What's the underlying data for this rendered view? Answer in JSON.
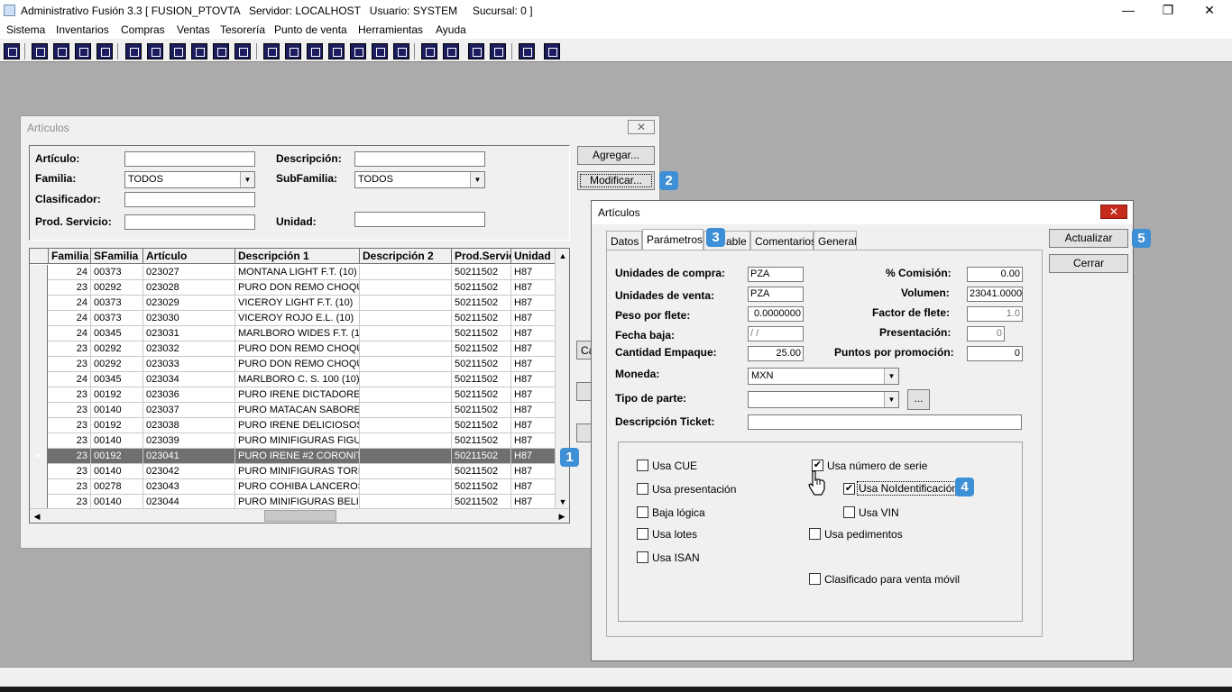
{
  "app": {
    "title": "Administrativo Fusión 3.3 [ FUSION_PTOVTA   Servidor: LOCALHOST   Usuario: SYSTEM     Sucursal: 0 ]",
    "controls": {
      "minimize": "—",
      "maximize": "❐",
      "close": "✕"
    }
  },
  "menu": [
    "Sistema",
    "Inventarios",
    "Compras",
    "Ventas",
    "Tesorería",
    "Punto de venta",
    "Herramientas",
    "Ayuda"
  ],
  "toolbar": {
    "icons": [
      "info-icon",
      "window-icon",
      "clipboard-icon",
      "transfer-icon",
      "search-doc-icon",
      "user-icon",
      "folder-icon",
      "export-icon",
      "print-icon",
      "document-icon",
      "list-icon",
      "people-icon",
      "box-icon",
      "move-icon",
      "add-icon",
      "dollar-icon",
      "report-icon",
      "file-icon",
      "home-icon",
      "zoom-icon",
      "refresh-icon",
      "undo-icon",
      "back-icon",
      "help-icon"
    ]
  },
  "articulos_list": {
    "title": "Artículos",
    "close": "✕",
    "filters": {
      "articulo_label": "Artículo:",
      "descripcion_label": "Descripción:",
      "familia_label": "Familia:",
      "familia_value": "TODOS",
      "subfamilia_label": "SubFamilia:",
      "subfamilia_value": "TODOS",
      "clasificador_label": "Clasificador:",
      "prodservicio_label": "Prod. Servicio:",
      "unidad_label": "Unidad:"
    },
    "buttons": {
      "agregar": "Agregar...",
      "modificar": "Modificar...",
      "partial_c": "Ca"
    },
    "badges": {
      "grid": "1",
      "modificar": "2"
    },
    "columns": [
      "Familia",
      "SFamilia",
      "Artículo",
      "Descripción 1",
      "Descripción 2",
      "Prod.Servic",
      "Unidad"
    ],
    "rows": [
      [
        "24",
        "00373",
        "023027",
        "MONTANA LIGHT F.T. (10)",
        "",
        "50211502",
        "H87"
      ],
      [
        "23",
        "00292",
        "023028",
        "PURO DON REMO CHOQUI",
        "",
        "50211502",
        "H87"
      ],
      [
        "24",
        "00373",
        "023029",
        "VICEROY LIGHT F.T. (10)",
        "",
        "50211502",
        "H87"
      ],
      [
        "24",
        "00373",
        "023030",
        "VICEROY ROJO E.L. (10)",
        "",
        "50211502",
        "H87"
      ],
      [
        "24",
        "00345",
        "023031",
        "MARLBORO WIDES F.T. (1(",
        "",
        "50211502",
        "H87"
      ],
      [
        "23",
        "00292",
        "023032",
        "PURO DON REMO CHOQUI",
        "",
        "50211502",
        "H87"
      ],
      [
        "23",
        "00292",
        "023033",
        "PURO DON REMO CHOQUI",
        "",
        "50211502",
        "H87"
      ],
      [
        "24",
        "00345",
        "023034",
        "MARLBORO C. S. 100 (10)",
        "",
        "50211502",
        "H87"
      ],
      [
        "23",
        "00192",
        "023036",
        "PURO IRENE DICTADORES",
        "",
        "50211502",
        "H87"
      ],
      [
        "23",
        "00140",
        "023037",
        "PURO MATACAN SABORES",
        "",
        "50211502",
        "H87"
      ],
      [
        "23",
        "00192",
        "023038",
        "PURO IRENE DELICIOSOS",
        "",
        "50211502",
        "H87"
      ],
      [
        "23",
        "00140",
        "023039",
        "PURO MINIFIGURAS FIGUR",
        "",
        "50211502",
        "H87"
      ],
      [
        "23",
        "00192",
        "023041",
        "PURO IRENE #2 CORONIT.",
        "",
        "50211502",
        "H87"
      ],
      [
        "23",
        "00140",
        "023042",
        "PURO MINIFIGURAS TORBI",
        "",
        "50211502",
        "H87"
      ],
      [
        "23",
        "00278",
        "023043",
        "PURO COHIBA LANCEROS",
        "",
        "50211502",
        "H87"
      ],
      [
        "23",
        "00140",
        "023044",
        "PURO MINIFIGURAS BELIC",
        "",
        "50211502",
        "H87"
      ]
    ],
    "selected_row": 12
  },
  "articulo_dialog": {
    "title": "Artículos",
    "close": "✕",
    "tabs": [
      "Datos",
      "Parámetros",
      "able",
      "Comentarios",
      "General"
    ],
    "active_tab": "Parámetros",
    "badges": {
      "tab": "3",
      "checkbox": "4",
      "actualizar": "5"
    },
    "buttons": {
      "actualizar": "Actualizar",
      "cerrar": "Cerrar"
    },
    "fields": {
      "unidades_compra_label": "Unidades de compra:",
      "unidades_compra": "PZA",
      "unidades_venta_label": "Unidades de venta:",
      "unidades_venta": "PZA",
      "peso_flete_label": "Peso por flete:",
      "peso_flete": "0.0000000",
      "fecha_baja_label": "Fecha baja:",
      "fecha_baja": " / /",
      "cantidad_empaque_label": "Cantidad Empaque:",
      "cantidad_empaque": "25.00",
      "comision_label": "% Comisión:",
      "comision": "0.00",
      "volumen_label": "Volumen:",
      "volumen": "23041.0000",
      "factor_flete_label": "Factor de flete:",
      "factor_flete": "1.0",
      "presentacion_label": "Presentación:",
      "presentacion": "0",
      "puntos_label": "Puntos por promoción:",
      "puntos": "0",
      "moneda_label": "Moneda:",
      "moneda": "MXN",
      "tipo_parte_label": "Tipo de parte:",
      "tipo_parte": "",
      "tipo_parte_btn": "...",
      "desc_ticket_label": "Descripción Ticket:",
      "desc_ticket": ""
    },
    "checkboxes": {
      "usa_cue": {
        "label": "Usa CUE",
        "checked": false
      },
      "usa_presentacion": {
        "label": "Usa presentación",
        "checked": false
      },
      "baja_logica": {
        "label": "Baja lógica",
        "checked": false
      },
      "usa_lotes": {
        "label": "Usa lotes",
        "checked": false
      },
      "usa_isan": {
        "label": "Usa ISAN",
        "checked": false
      },
      "usa_numero_serie": {
        "label": "Usa número de serie",
        "checked": true
      },
      "usa_noidentificacion": {
        "label": "Usa NoIdentificación",
        "checked": true
      },
      "usa_vin": {
        "label": "Usa VIN",
        "checked": false
      },
      "usa_pedimentos": {
        "label": "Usa pedimentos",
        "checked": false
      },
      "clasificado_movil": {
        "label": "Clasificado para venta móvil",
        "checked": false
      }
    },
    "check_mark": "✔"
  }
}
